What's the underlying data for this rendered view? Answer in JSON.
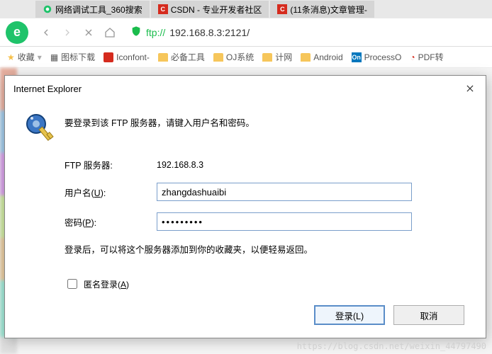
{
  "tabs": {
    "t0": "网络调试工具_360搜索",
    "t1": "CSDN - 专业开发者社区",
    "t2": "(11条消息)文章管理-"
  },
  "address": {
    "scheme": "ftp://",
    "url": "192.168.8.3:2121/"
  },
  "bookmarks": {
    "fav": "收藏",
    "b0": "图标下载",
    "b1": "Iconfont-",
    "b2": "必备工具",
    "b3": "OJ系统",
    "b4": "计网",
    "b5": "Android",
    "b6": "ProcessO",
    "b7": "PDF转"
  },
  "dialog": {
    "title": "Internet Explorer",
    "prompt": "要登录到该 FTP 服务器，请键入用户名和密码。",
    "server_label": "FTP 服务器:",
    "server_value": "192.168.8.3",
    "user_label_pre": "用户名(",
    "user_label_u": "U",
    "user_label_post": "):",
    "user_value": "zhangdashuaibi",
    "pass_label_pre": "密码(",
    "pass_label_u": "P",
    "pass_label_post": "):",
    "pass_value": "•••••••••",
    "hint": "登录后，可以将这个服务器添加到你的收藏夹，以便轻易返回。",
    "anon_pre": "匿名登录(",
    "anon_u": "A",
    "anon_post": ")",
    "login_btn": "登录(L)",
    "cancel_btn": "取消"
  },
  "watermark": "https://blog.csdn.net/weixin_44797490"
}
